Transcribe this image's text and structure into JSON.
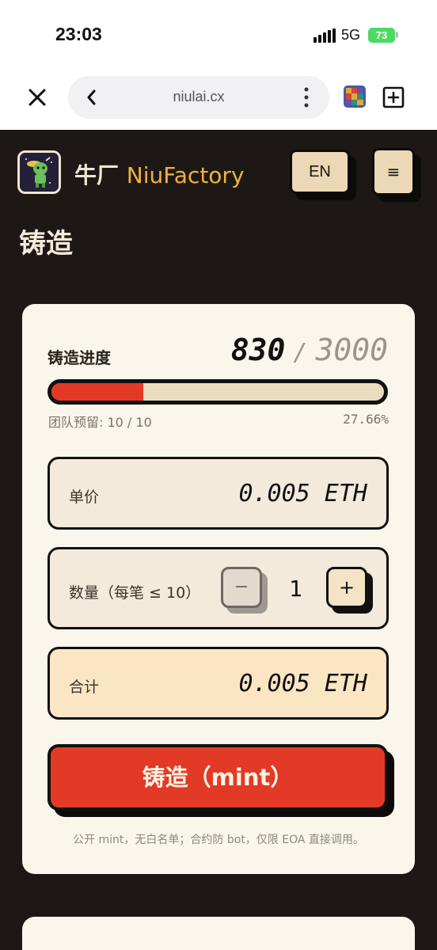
{
  "status_bar": {
    "time": "23:03",
    "network": "5G",
    "battery": "73"
  },
  "browser": {
    "url": "niulai.cx"
  },
  "header": {
    "brand_cn": "牛厂",
    "brand_en": "NiuFactory",
    "lang_button": "EN",
    "menu_icon": "≡"
  },
  "page_title": "铸造",
  "mint": {
    "progress_label": "铸造进度",
    "minted": "830",
    "separator": "/",
    "total": "3000",
    "progress_fraction": 0.2766,
    "reserve_text": "团队预留: 10 / 10",
    "percent_text": "27.66%",
    "price_label": "单价",
    "price_value": "0.005 ETH",
    "quantity_label": "数量（每笔 ≤ 10）",
    "quantity_minus": "−",
    "quantity_value": "1",
    "quantity_plus": "+",
    "total_label": "合计",
    "total_value": "0.005 ETH",
    "mint_button": "铸造（mint）",
    "note": "公开 mint，无白名单；合约防 bot，仅限 EOA 直接调用。"
  },
  "colors": {
    "page_bg": "#1d1815",
    "card_bg": "#fbf6ec",
    "accent_red": "#e23a26",
    "brand_yellow": "#f0b23c",
    "button_beige": "#ecd8b6"
  }
}
